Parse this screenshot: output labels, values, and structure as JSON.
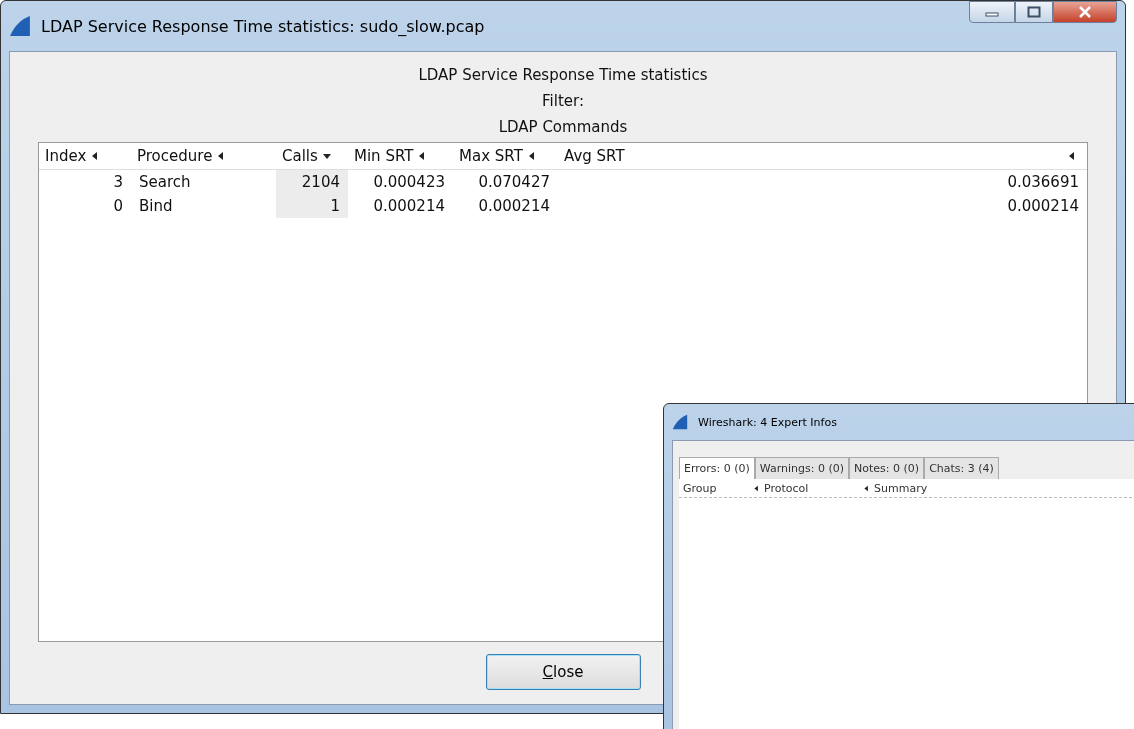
{
  "window": {
    "title": "LDAP Service Response Time statistics: sudo_slow.pcap"
  },
  "header": [
    "LDAP Service Response Time statistics",
    "Filter:",
    "LDAP Commands"
  ],
  "table": {
    "columns": [
      {
        "label": "Index",
        "sorted": false
      },
      {
        "label": "Procedure",
        "sorted": false
      },
      {
        "label": "Calls",
        "sorted": true
      },
      {
        "label": "Min SRT",
        "sorted": false
      },
      {
        "label": "Max SRT",
        "sorted": false
      },
      {
        "label": "Avg SRT",
        "sorted": false
      }
    ],
    "rows": [
      [
        "3",
        "Search",
        "2104",
        "0.000423",
        "0.070427",
        "0.036691"
      ],
      [
        "0",
        "Bind",
        "1",
        "0.000214",
        "0.000214",
        "0.000214"
      ]
    ]
  },
  "buttons": [
    "Close"
  ],
  "expert_window": {
    "title": "Wireshark: 4 Expert Infos",
    "tabs": [
      {
        "label": "Errors: 0 (0)",
        "selected": true
      },
      {
        "label": "Warnings: 0 (0)",
        "selected": false
      },
      {
        "label": "Notes: 0 (0)",
        "selected": false
      },
      {
        "label": "Chats: 3 (4)",
        "selected": false
      }
    ],
    "columns": [
      "Group",
      "Protocol",
      "Summary"
    ]
  }
}
